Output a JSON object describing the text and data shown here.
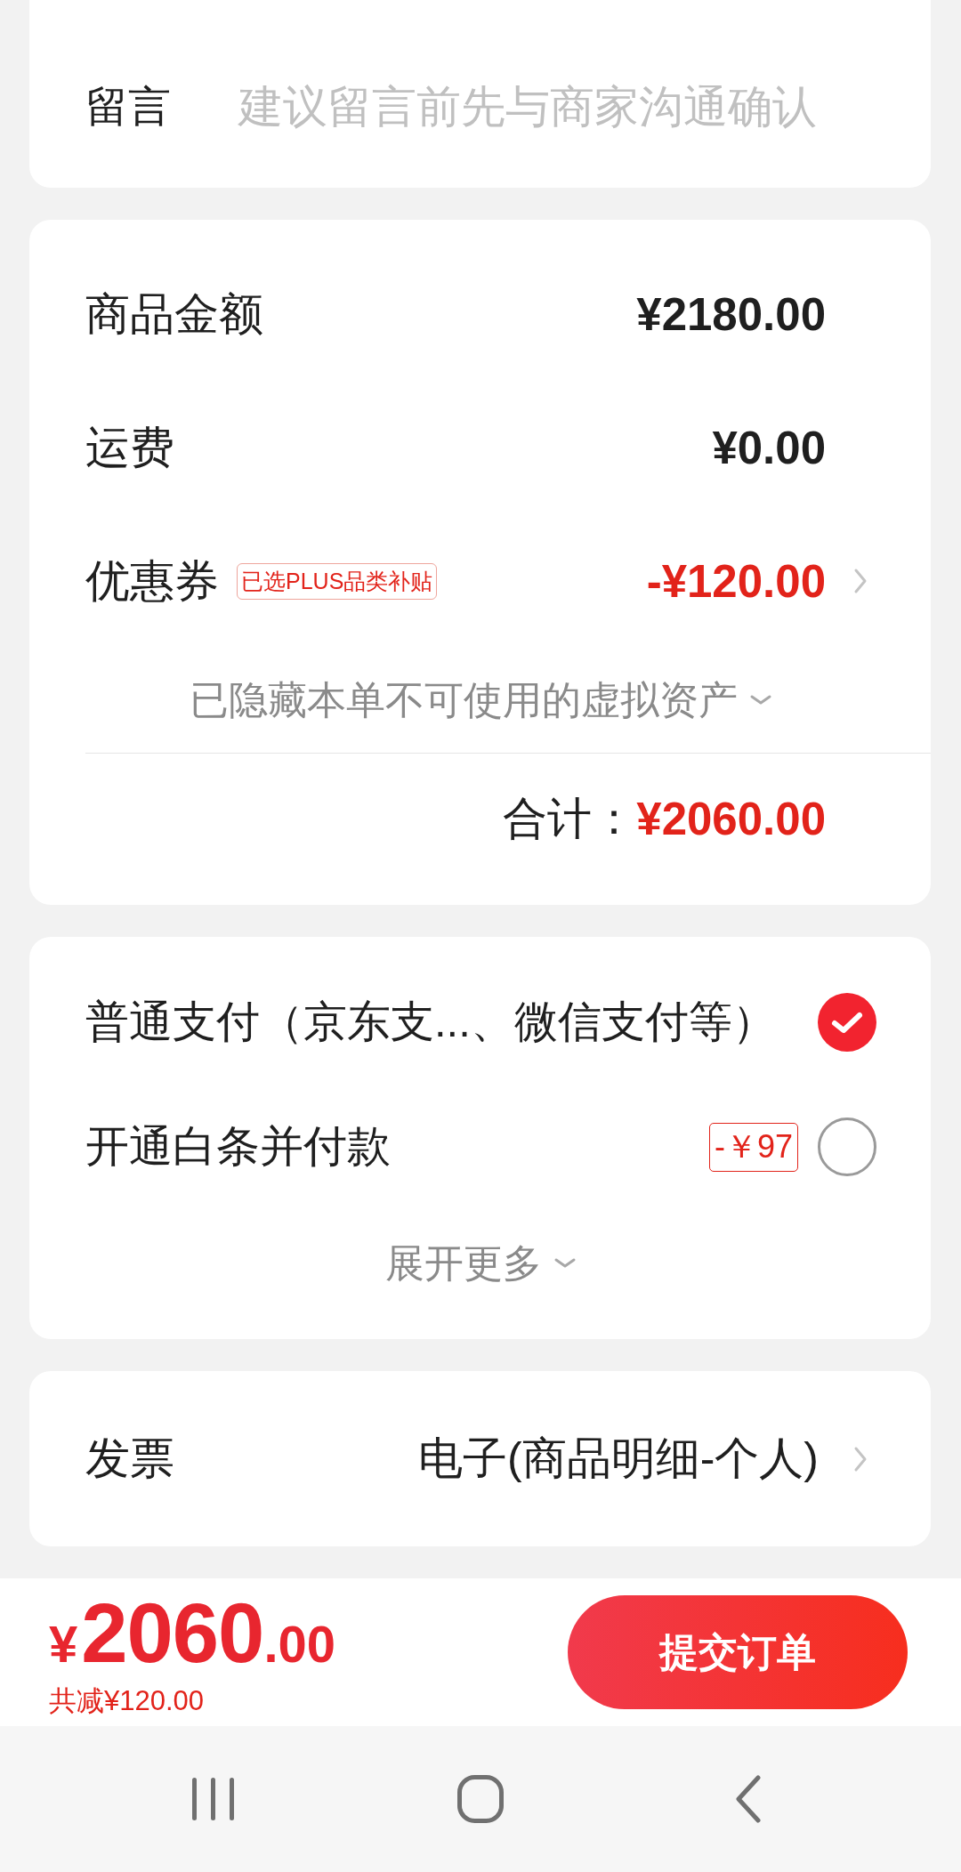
{
  "note": {
    "label": "留言",
    "placeholder": "建议留言前先与商家沟通确认"
  },
  "summary": {
    "rows": [
      {
        "kind": "amount",
        "label": "商品金额",
        "value": "¥2180.00"
      },
      {
        "kind": "amount",
        "label": "运费",
        "value": "¥0.00"
      },
      {
        "kind": "coupon",
        "label": "优惠券",
        "tag": "已选PLUS品类补贴",
        "value": "-¥120.00"
      }
    ],
    "hidden_assets": "已隐藏本单不可使用的虚拟资产",
    "total_label": "合计：",
    "total_value": "¥2060.00"
  },
  "payment": {
    "options": [
      {
        "label": "普通支付（京东支...、微信支付等）",
        "selected": true
      },
      {
        "label": "开通白条并付款",
        "tag": "-￥97",
        "selected": false
      }
    ],
    "expand": "展开更多"
  },
  "invoice": {
    "label": "发票",
    "value": "电子(商品明细-个人)"
  },
  "bottom_bar": {
    "currency": "¥",
    "amount": "2060",
    "decimals": ".00",
    "discount": "共减¥120.00",
    "submit": "提交订单"
  }
}
